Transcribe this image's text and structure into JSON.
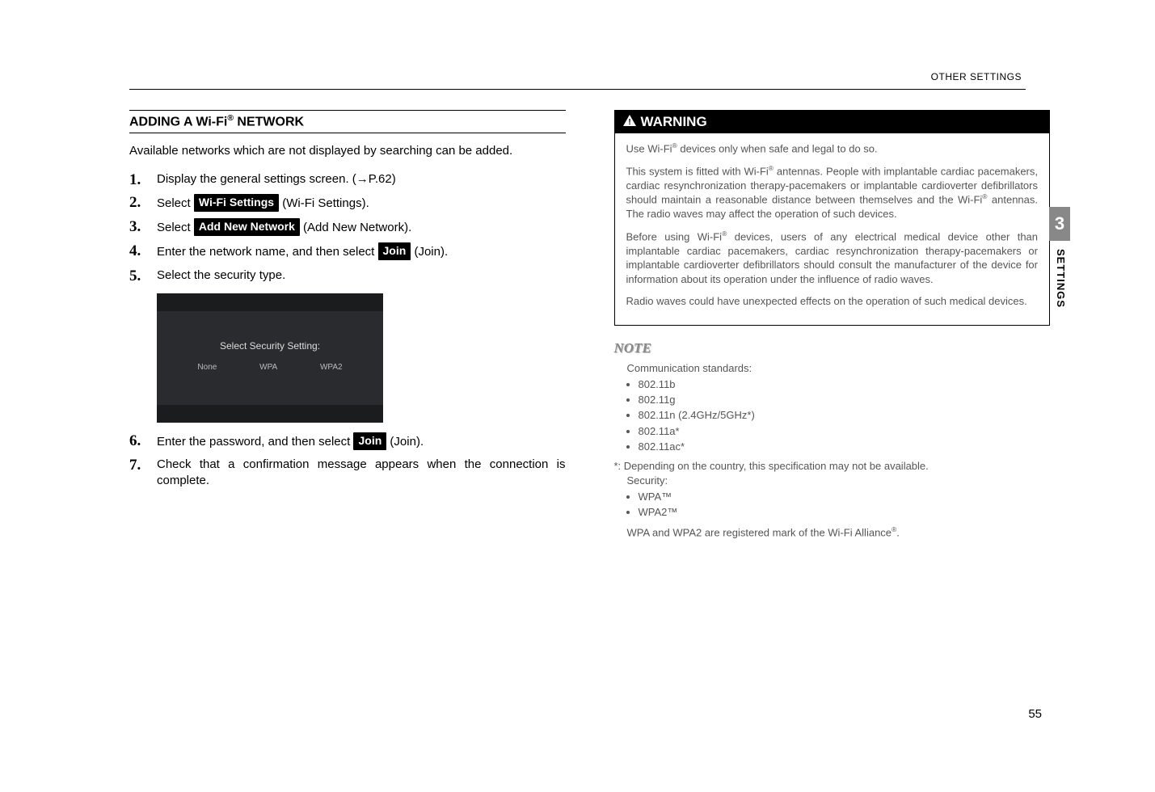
{
  "header": {
    "category": "OTHER SETTINGS"
  },
  "left": {
    "section_title_pre": "ADDING A Wi-Fi",
    "section_title_sup": "®",
    "section_title_post": " NETWORK",
    "intro": "Available networks which are not displayed by searching can be added.",
    "steps": {
      "s1": "Display the general settings screen. (→P.62)",
      "s2a": "Select ",
      "s2btn": "Wi-Fi Settings",
      "s2b": " (Wi-Fi Settings).",
      "s3a": "Select ",
      "s3btn": "Add New Network",
      "s3b": " (Add New Network).",
      "s4a": "Enter the network name, and then select ",
      "s4btn": "Join",
      "s4b": " (Join).",
      "s5": "Select the security type.",
      "s6a": "Enter the password, and then select ",
      "s6btn": "Join",
      "s6b": " (Join).",
      "s7": "Check that a confirmation message appears when the connection is complete."
    },
    "screenshot": {
      "title": "Select Security Setting:",
      "opt1": "None",
      "opt2": "WPA",
      "opt3": "WPA2"
    }
  },
  "right": {
    "warning_label": "WARNING",
    "warning": {
      "p1a": "Use Wi-Fi",
      "p1sup": "®",
      "p1b": " devices only when safe and legal to do so.",
      "p2a": "This system is fitted with Wi-Fi",
      "p2sup": "®",
      "p2b": " antennas. People with implantable cardiac pacemakers, cardiac resynchronization therapy-pacemakers or implantable cardioverter defibrillators should maintain a reasonable distance between themselves and the Wi-Fi",
      "p2sup2": "®",
      "p2c": " antennas. The radio waves may affect the operation of such devices.",
      "p3a": "Before using Wi-Fi",
      "p3sup": "®",
      "p3b": " devices, users of any electrical medical device other than implantable cardiac pacemakers, cardiac resynchronization therapy-pacemakers or implantable cardioverter defibrillators should consult the manufacturer of the device for information about its operation under the influence of radio waves.",
      "p4": "Radio waves could have unexpected effects on the operation of such medical devices."
    },
    "note": {
      "heading": "NOTE",
      "comm_label": "Communication standards:",
      "std1": "802.11b",
      "std2": "802.11g",
      "std3": "802.11n (2.4GHz/5GHz*)",
      "std4": "802.11a*",
      "std5": "802.11ac*",
      "star": "*:  Depending on the country, this specification may not be available.",
      "sec_label": "Security:",
      "sec1": "WPA™",
      "sec2": "WPA2™",
      "trademark_a": "WPA and WPA2 are registered mark of the Wi-Fi Alliance",
      "trademark_sup": "®",
      "trademark_b": "."
    }
  },
  "side": {
    "num": "3",
    "label": "SETTINGS"
  },
  "page_number": "55"
}
